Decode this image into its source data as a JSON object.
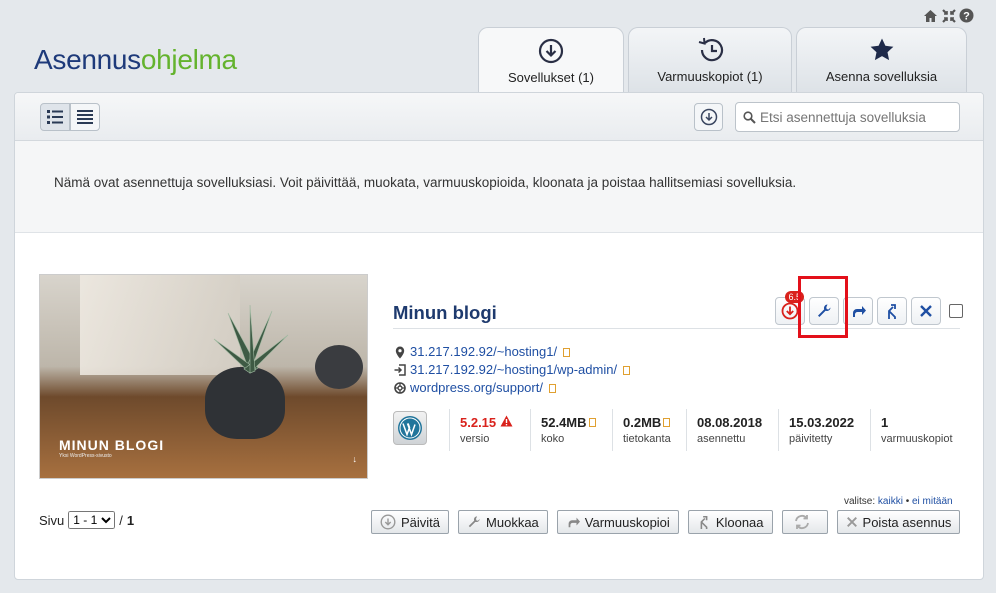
{
  "logo": {
    "part1": "Asennus",
    "part2": "ohjelma"
  },
  "tabs": [
    {
      "label": "Sovellukset (1)"
    },
    {
      "label": "Varmuuskopiot (1)"
    },
    {
      "label": "Asenna sovelluksia"
    }
  ],
  "search": {
    "placeholder": "Etsi asennettuja sovelluksia"
  },
  "info_text": "Nämä ovat asennettuja sovelluksiasi. Voit päivittää, muokata, varmuuskopioida, kloonata ja poistaa hallitsemiasi sovelluksia.",
  "app": {
    "thumb_title": "MINUN BLOGI",
    "thumb_subtitle": "Yksi WordPress-sivusto",
    "title": "Minun blogi",
    "update_badge": "6.5",
    "links": [
      "31.217.192.92/~hosting1/",
      "31.217.192.92/~hosting1/wp-admin/",
      "wordpress.org/support/"
    ],
    "stats": [
      {
        "value": "5.2.15",
        "label": "versio",
        "color": "#d9221c"
      },
      {
        "value": "52.4MB",
        "label": "koko"
      },
      {
        "value": "0.2MB",
        "label": "tietokanta"
      },
      {
        "value": "08.08.2018",
        "label": "asennettu"
      },
      {
        "value": "15.03.2022",
        "label": "päivitetty"
      },
      {
        "value": "1",
        "label": "varmuuskopiot"
      }
    ]
  },
  "select": {
    "prefix": "valitse:",
    "all": "kaikki",
    "sep": "•",
    "none": "ei mitään"
  },
  "pager": {
    "label": "Sivu",
    "selected": "1 - 1",
    "slash": "/",
    "total": "1"
  },
  "bottom_buttons": [
    "Päivitä",
    "Muokkaa",
    "Varmuuskopioi",
    "Kloonaa",
    "",
    "Poista asennus"
  ],
  "colors": {
    "brand_dark": "#1e3a7a",
    "brand_green": "#64b32e",
    "highlight": "#e3101a"
  }
}
